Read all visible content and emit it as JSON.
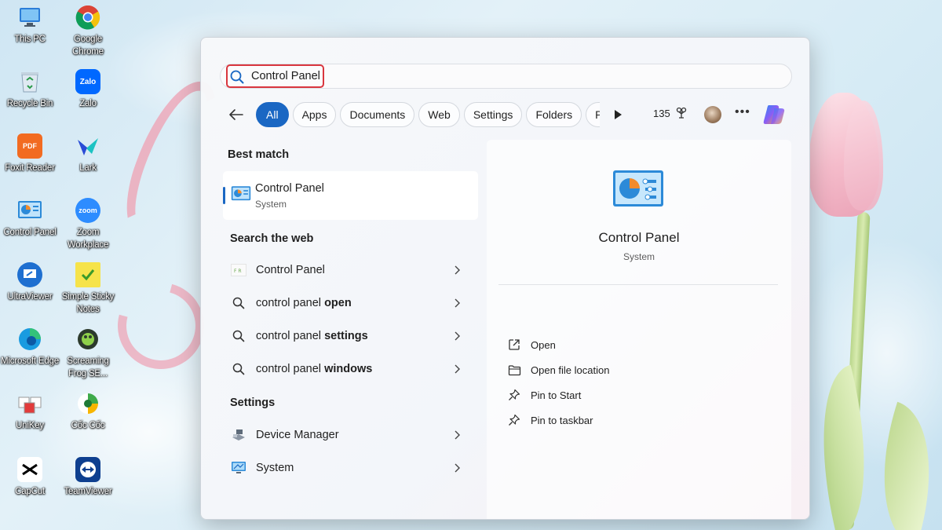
{
  "desktop": {
    "icons": [
      {
        "label": "This PC",
        "color": "#2b7dd8"
      },
      {
        "label": "Google Chrome",
        "color": "#ffffff"
      },
      {
        "label": "Recycle Bin",
        "color": "#dfe9f2"
      },
      {
        "label": "Zalo",
        "color": "#0068ff"
      },
      {
        "label": "Foxit Reader",
        "color": "#f26b21"
      },
      {
        "label": "Lark",
        "color": "#ffffff"
      },
      {
        "label": "Control Panel",
        "color": "#2c8ad8"
      },
      {
        "label": "Zoom Workplace",
        "color": "#2d8cff"
      },
      {
        "label": "UltraViewer",
        "color": "#1e6fd0"
      },
      {
        "label": "Simple Sticky Notes",
        "color": "#f6e34a"
      },
      {
        "label": "Microsoft Edge",
        "color": "#1a9be0"
      },
      {
        "label": "Screaming Frog SE...",
        "color": "#2c3a2c"
      },
      {
        "label": "UniKey",
        "color": "#ffffff"
      },
      {
        "label": "Cốc Cốc",
        "color": "#ffffff"
      },
      {
        "label": "CapCut",
        "color": "#ffffff"
      },
      {
        "label": "TeamViewer",
        "color": "#0e3f8f"
      }
    ]
  },
  "search": {
    "value": "Control Panel",
    "highlight_color": "#d9363e"
  },
  "filters": {
    "chips": [
      "All",
      "Apps",
      "Documents",
      "Web",
      "Settings",
      "Folders",
      "Ph"
    ],
    "active": "All",
    "rewards_points": "135"
  },
  "results": {
    "best_match_heading": "Best match",
    "best_match": {
      "title": "Control Panel",
      "subtitle": "System"
    },
    "web_heading": "Search the web",
    "web_items": [
      {
        "prefix": "Control Panel",
        "bold": "",
        "icon": "web-result-icon"
      },
      {
        "prefix": "control panel ",
        "bold": "open",
        "icon": "search-icon"
      },
      {
        "prefix": "control panel ",
        "bold": "settings",
        "icon": "search-icon"
      },
      {
        "prefix": "control panel ",
        "bold": "windows",
        "icon": "search-icon"
      }
    ],
    "settings_heading": "Settings",
    "settings_items": [
      {
        "label": "Device Manager",
        "icon": "device-manager-icon"
      },
      {
        "label": "System",
        "icon": "system-icon"
      }
    ]
  },
  "detail": {
    "title": "Control Panel",
    "subtitle": "System",
    "actions": [
      {
        "label": "Open",
        "icon": "open-external-icon"
      },
      {
        "label": "Open file location",
        "icon": "folder-icon"
      },
      {
        "label": "Pin to Start",
        "icon": "pin-icon"
      },
      {
        "label": "Pin to taskbar",
        "icon": "pin-icon"
      }
    ]
  },
  "colors": {
    "accent": "#1a67c3"
  }
}
